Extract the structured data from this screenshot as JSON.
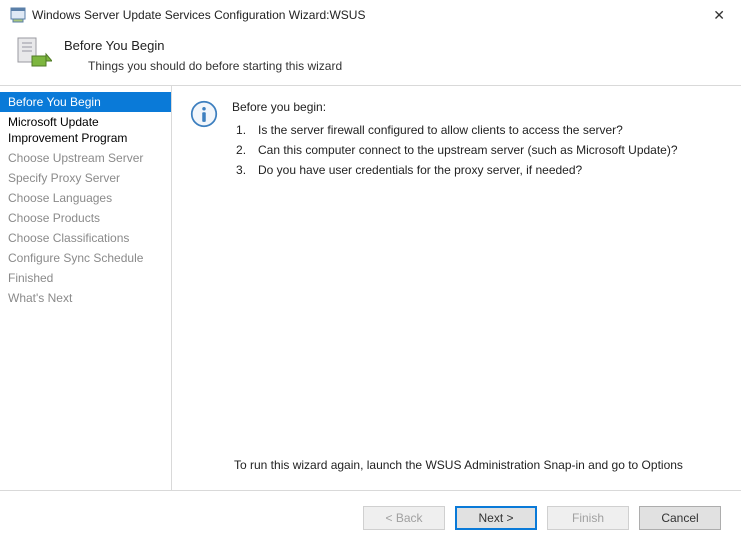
{
  "window": {
    "title": "Windows Server Update Services Configuration Wizard:WSUS"
  },
  "header": {
    "heading": "Before You Begin",
    "sub": "Things you should do before starting this wizard"
  },
  "sidebar": {
    "steps": [
      {
        "label": "Before You Begin",
        "state": "selected"
      },
      {
        "label": "Microsoft Update Improvement Program",
        "state": "active-group"
      },
      {
        "label": "Choose Upstream Server",
        "state": "upcoming"
      },
      {
        "label": "Specify Proxy Server",
        "state": "upcoming"
      },
      {
        "label": "Choose Languages",
        "state": "upcoming"
      },
      {
        "label": "Choose Products",
        "state": "upcoming"
      },
      {
        "label": "Choose Classifications",
        "state": "upcoming"
      },
      {
        "label": "Configure Sync Schedule",
        "state": "upcoming"
      },
      {
        "label": "Finished",
        "state": "upcoming"
      },
      {
        "label": "What's Next",
        "state": "upcoming"
      }
    ]
  },
  "content": {
    "lead": "Before you begin:",
    "items": [
      "Is the server firewall configured to allow clients to access the server?",
      "Can this computer connect to the upstream server (such as Microsoft Update)?",
      "Do you have user credentials for the proxy server, if needed?"
    ],
    "footer_note": "To run this wizard again, launch the WSUS Administration Snap-in and go to Options"
  },
  "buttons": {
    "back": "< Back",
    "next": "Next >",
    "finish": "Finish",
    "cancel": "Cancel"
  }
}
